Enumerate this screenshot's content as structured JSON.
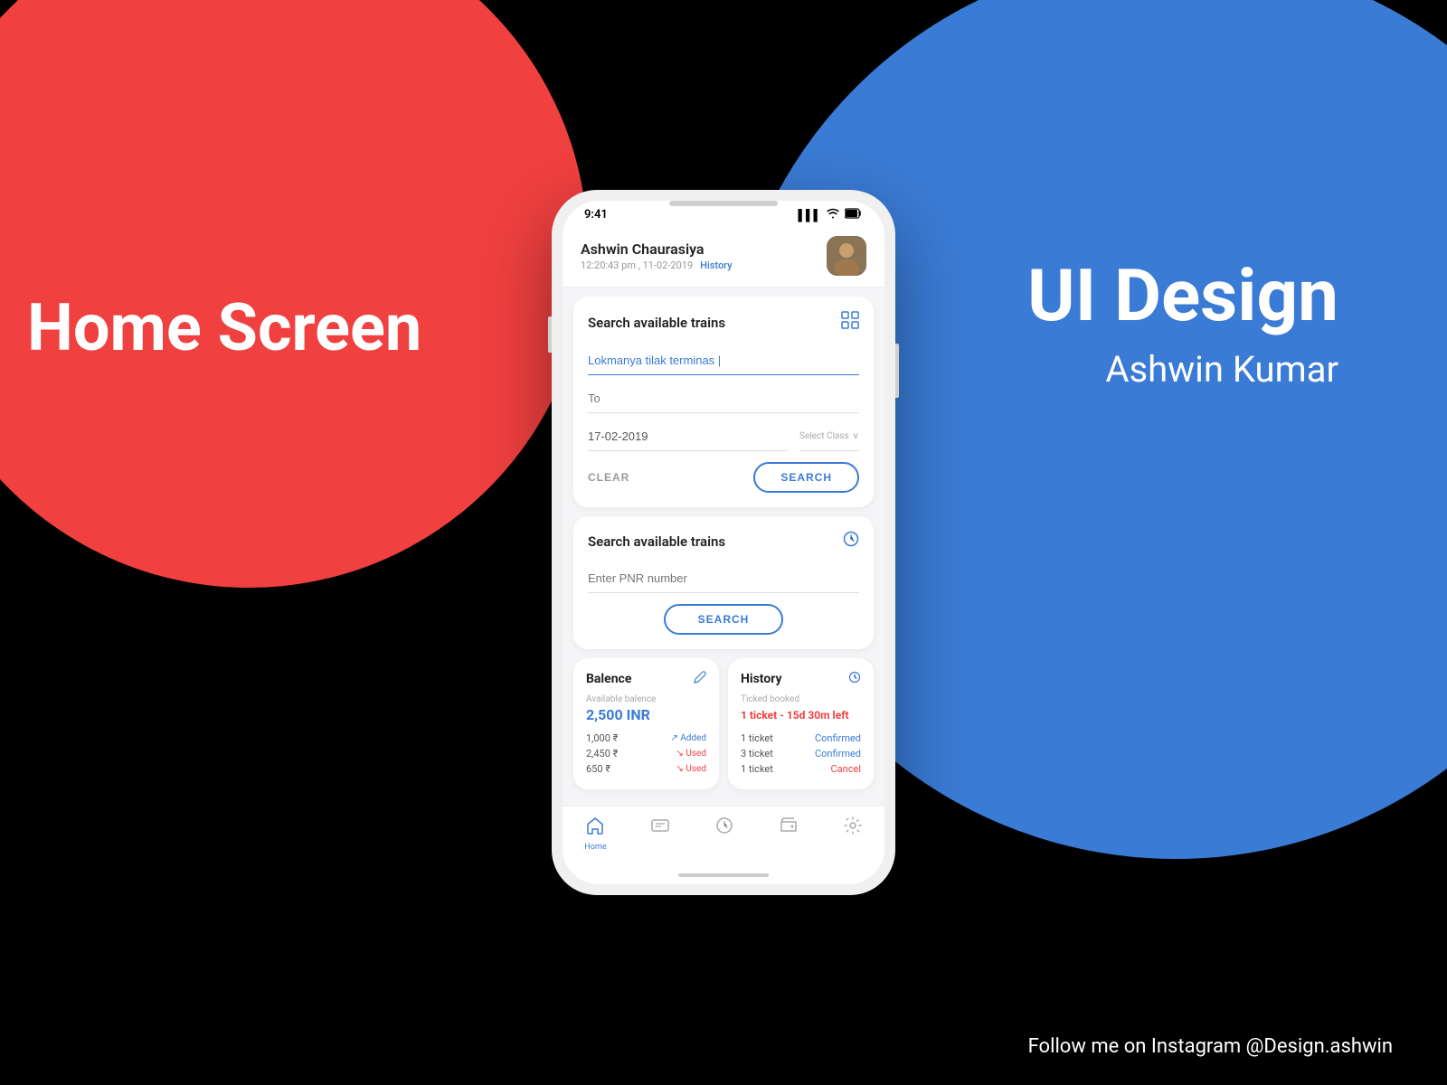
{
  "background": {
    "red_circle_color": "#f04040",
    "blue_circle_color": "#3a7bd5",
    "black_bg": "#000000"
  },
  "labels": {
    "home_screen": "Home Screen",
    "ui_design": "UI Design",
    "designer_name": "Ashwin Kumar",
    "follow_text": "Follow me on Instagram @Design.ashwin"
  },
  "status_bar": {
    "time": "9:41",
    "signal": "▌▌▌",
    "wifi": "◈",
    "battery": "▮▮▮"
  },
  "user_header": {
    "name": "Ashwin Chaurasiya",
    "datetime": "12:20:43 pm , 11-02-2019",
    "history_link": "History"
  },
  "search_trains_card": {
    "title": "Search available trains",
    "icon": "⊞",
    "from_value": "Lokmanya tilak terminas |",
    "to_placeholder": "To",
    "date_value": "17-02-2019",
    "class_label": "Select Class",
    "class_arrow": "∨",
    "clear_button": "CLEAR",
    "search_button": "SEARCH"
  },
  "pnr_card": {
    "title": "Search available trains",
    "icon": "⏱",
    "pnr_placeholder": "Enter PNR number",
    "search_button": "SEARCH"
  },
  "balance_card": {
    "title": "Balence",
    "icon": "✏",
    "available_label": "Available balence",
    "amount": "2,500 INR",
    "rows": [
      {
        "amount": "1,000 ₹",
        "label": "Added",
        "type": "added"
      },
      {
        "amount": "2,450 ₹",
        "label": "Used",
        "type": "used"
      },
      {
        "amount": "650 ₹",
        "label": "Used",
        "type": "used"
      }
    ]
  },
  "history_card": {
    "title": "History",
    "icon": "⏱",
    "subtitle": "Ticked booked",
    "highlight": "1 ticket - 15d 30m left",
    "rows": [
      {
        "count": "1 ticket",
        "status": "Confirmed",
        "type": "confirmed"
      },
      {
        "count": "3 ticket",
        "status": "Confirmed",
        "type": "confirmed"
      },
      {
        "count": "1 ticket",
        "status": "Cancel",
        "type": "cancel"
      }
    ]
  },
  "bottom_nav": {
    "items": [
      {
        "icon": "⌂",
        "label": "Home",
        "active": true
      },
      {
        "icon": "▤",
        "label": "",
        "active": false
      },
      {
        "icon": "◷",
        "label": "",
        "active": false
      },
      {
        "icon": "✂",
        "label": "",
        "active": false
      },
      {
        "icon": "⚙",
        "label": "",
        "active": false
      }
    ]
  }
}
